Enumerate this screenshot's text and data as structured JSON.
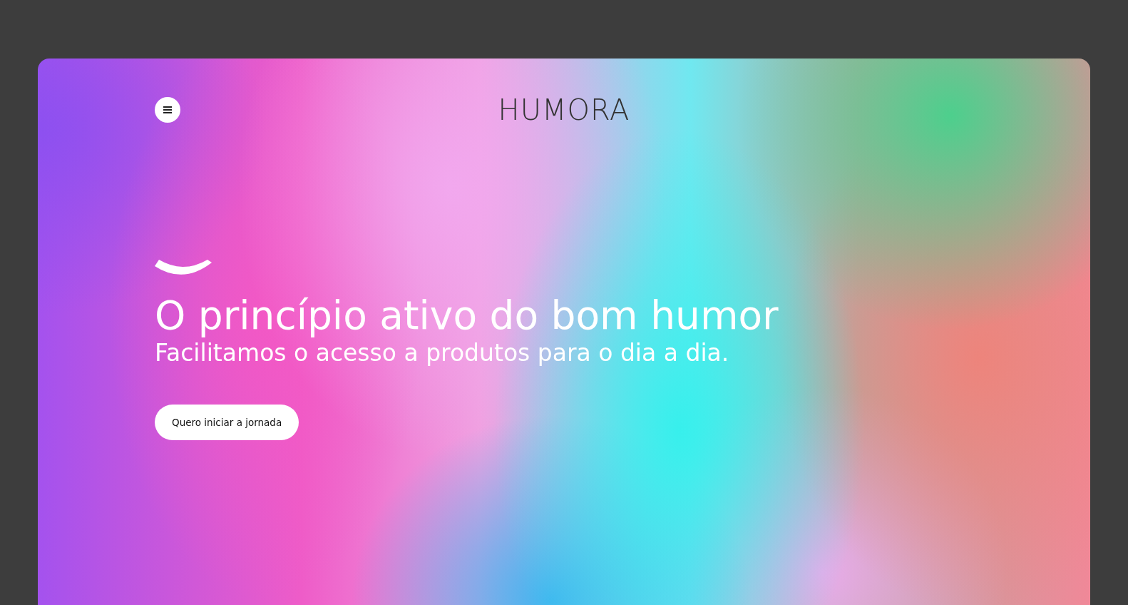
{
  "header": {
    "logo": "HUMORA"
  },
  "hero": {
    "title": "O princípio ativo do bom humor",
    "subtitle": "Facilitamos o acesso a produtos para o dia a dia.",
    "button": "Quero iniciar a jornada"
  }
}
